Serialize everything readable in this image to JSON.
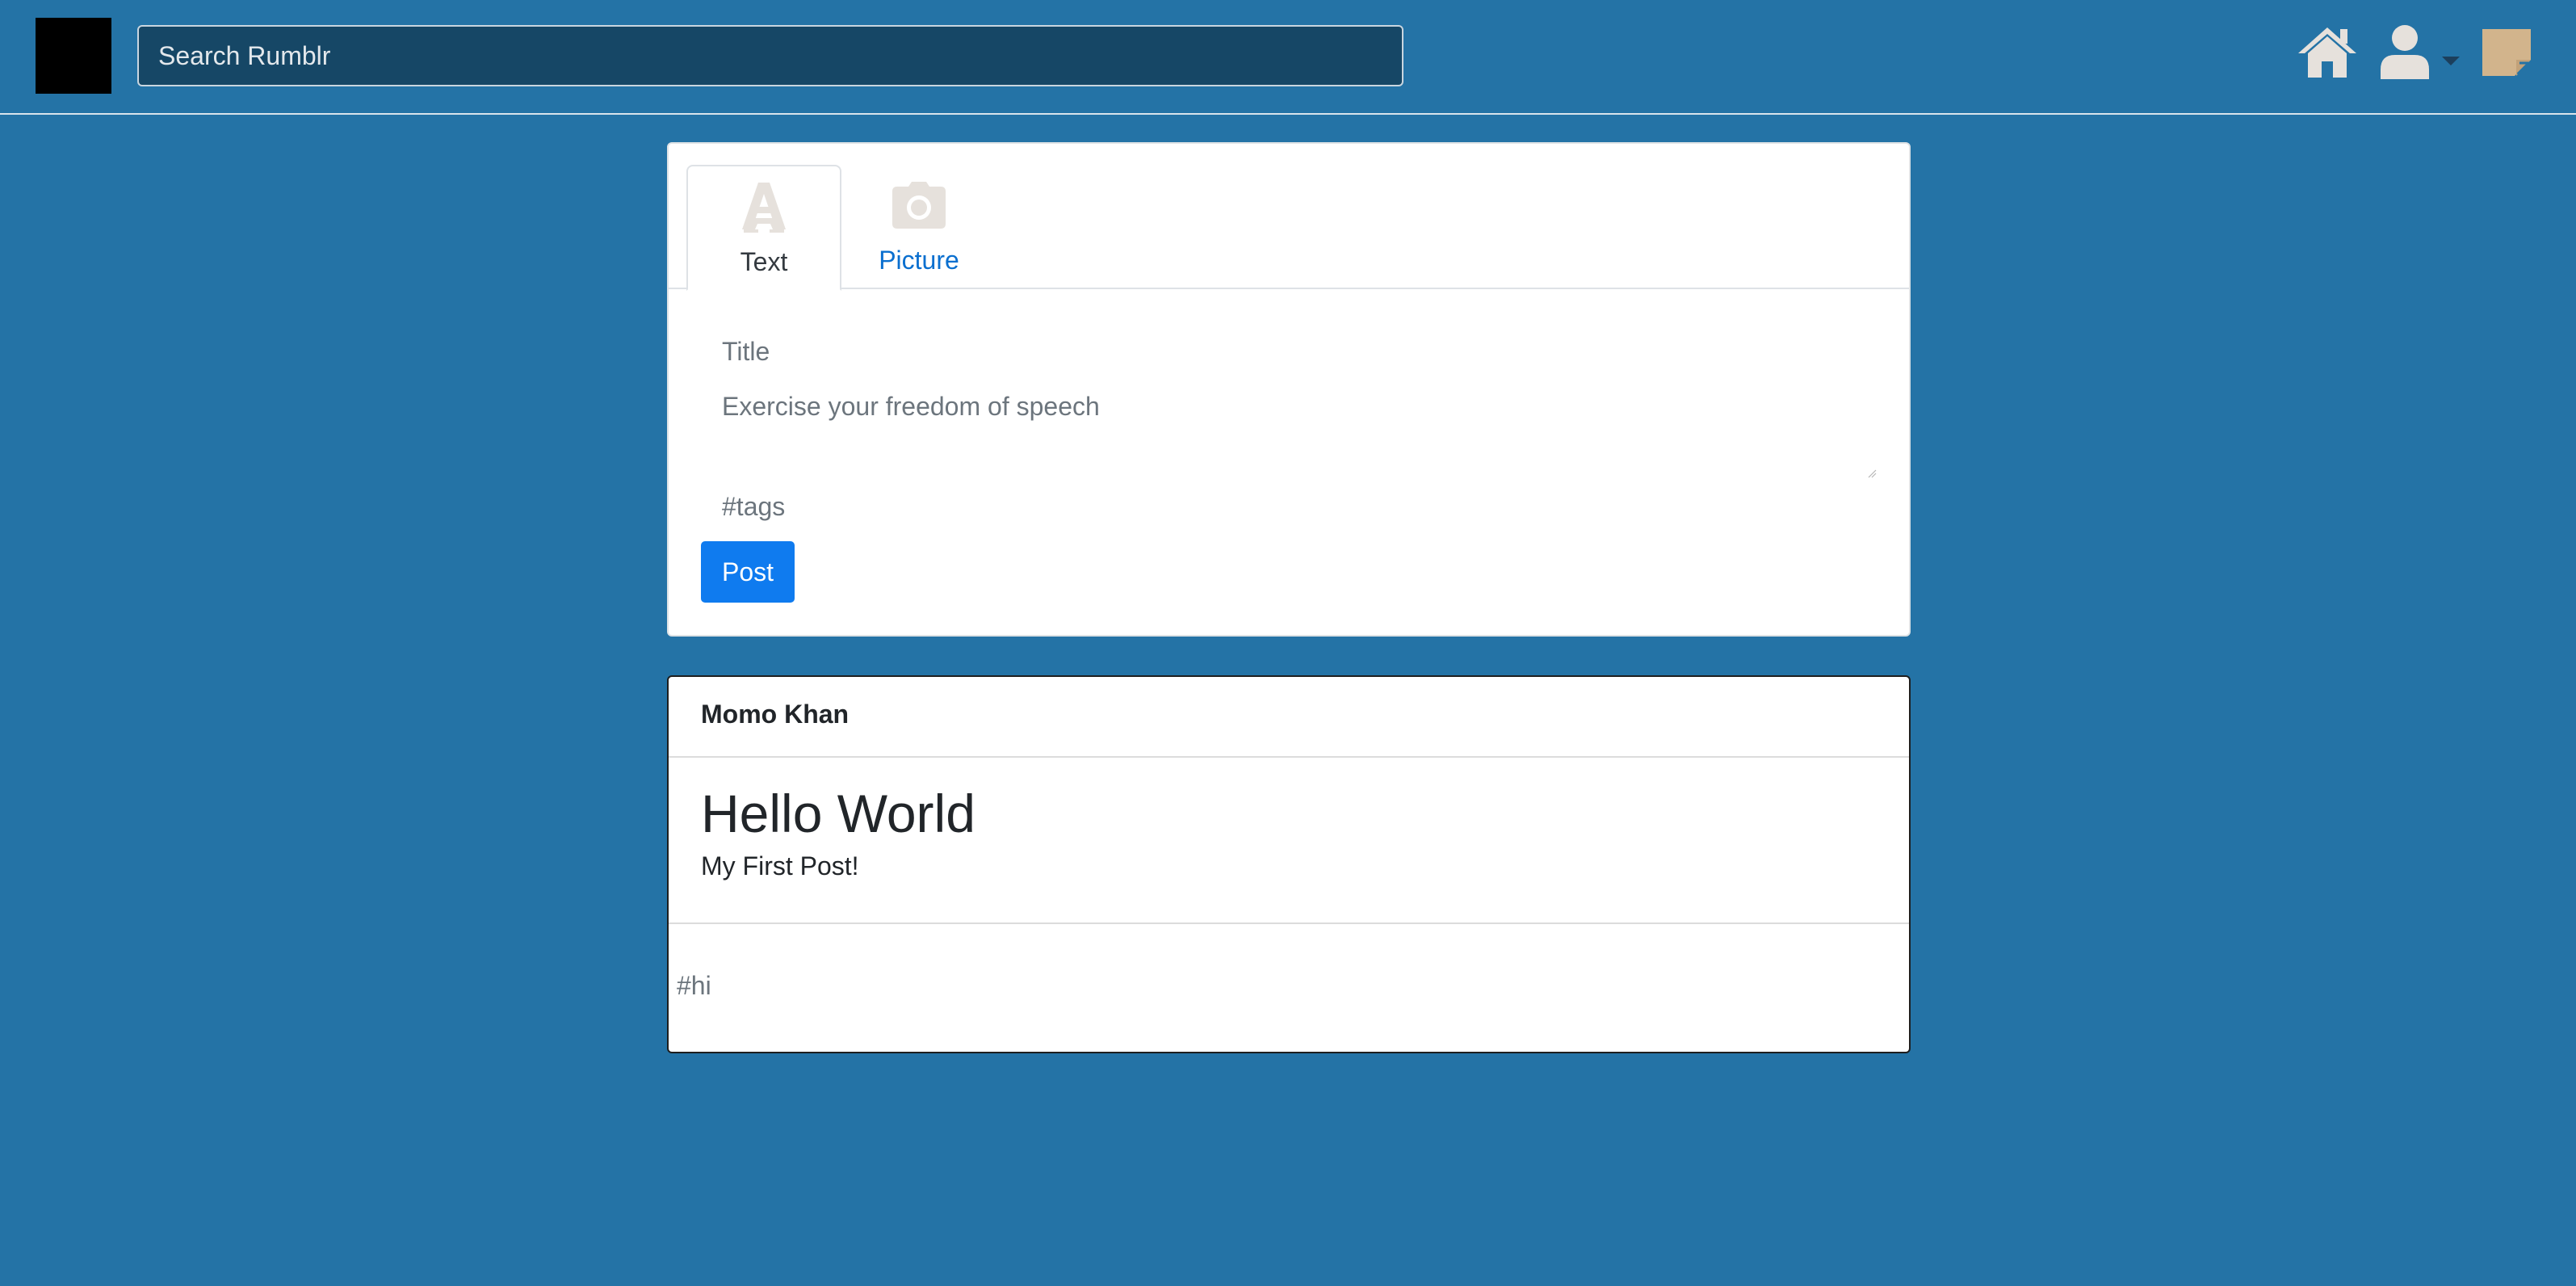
{
  "navbar": {
    "search_placeholder": "Search Rumblr",
    "icons": [
      "logo",
      "home-icon",
      "user-icon",
      "caret-down-icon",
      "notes-icon"
    ]
  },
  "composer": {
    "tabs": [
      {
        "label": "Text",
        "icon": "text-icon",
        "active": true
      },
      {
        "label": "Picture",
        "icon": "camera-icon",
        "active": false
      }
    ],
    "title_placeholder": "Title",
    "body_placeholder": "Exercise your freedom of speech",
    "tags_placeholder": "#tags",
    "post_button": "Post"
  },
  "post": {
    "author": "Momo Khan",
    "title": "Hello World",
    "body": "My First Post!",
    "tag": "#hi"
  },
  "colors": {
    "background": "#2473a6",
    "search_bg": "#164766",
    "primary_button": "#0f7bef",
    "link": "#0a6fcf",
    "icon_light": "#e6e1dc",
    "notes_icon": "#d2b48c"
  }
}
